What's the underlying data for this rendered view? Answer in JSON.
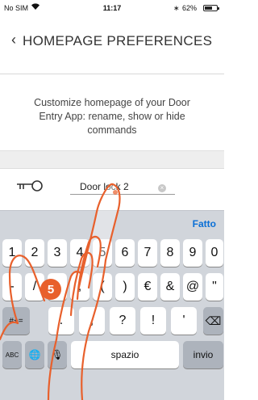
{
  "status_bar": {
    "carrier": "No SIM",
    "time": "11:17",
    "bluetooth": "∗",
    "battery_percent": "62%",
    "battery_level": 0.62
  },
  "header": {
    "back_icon": "‹",
    "title": "HOMEPAGE PREFERENCES"
  },
  "description": {
    "line1": "Customize homepage of your Door",
    "line2": "Entry App: rename, show or hide",
    "line3": "commands"
  },
  "command": {
    "icon": "key-icon",
    "name_value": "Door lock 2",
    "clear_icon": "×"
  },
  "keyboard": {
    "done_label": "Fatto",
    "row1": [
      "1",
      "2",
      "3",
      "4",
      "5",
      "6",
      "7",
      "8",
      "9",
      "0"
    ],
    "row2": [
      "-",
      "/",
      ":",
      ";",
      "(",
      ")",
      "€",
      "&",
      "@",
      "\""
    ],
    "row3": [
      "#+=",
      ".",
      ",",
      "?",
      "!",
      "'",
      "⌫"
    ],
    "row4": [
      "ABC",
      "🌐",
      "🎙",
      "spazio",
      "invio"
    ]
  },
  "step_badge": "5",
  "colors": {
    "accent": "#e8602c",
    "link": "#0a6fd6",
    "keyboard_bg": "#d1d5db"
  }
}
